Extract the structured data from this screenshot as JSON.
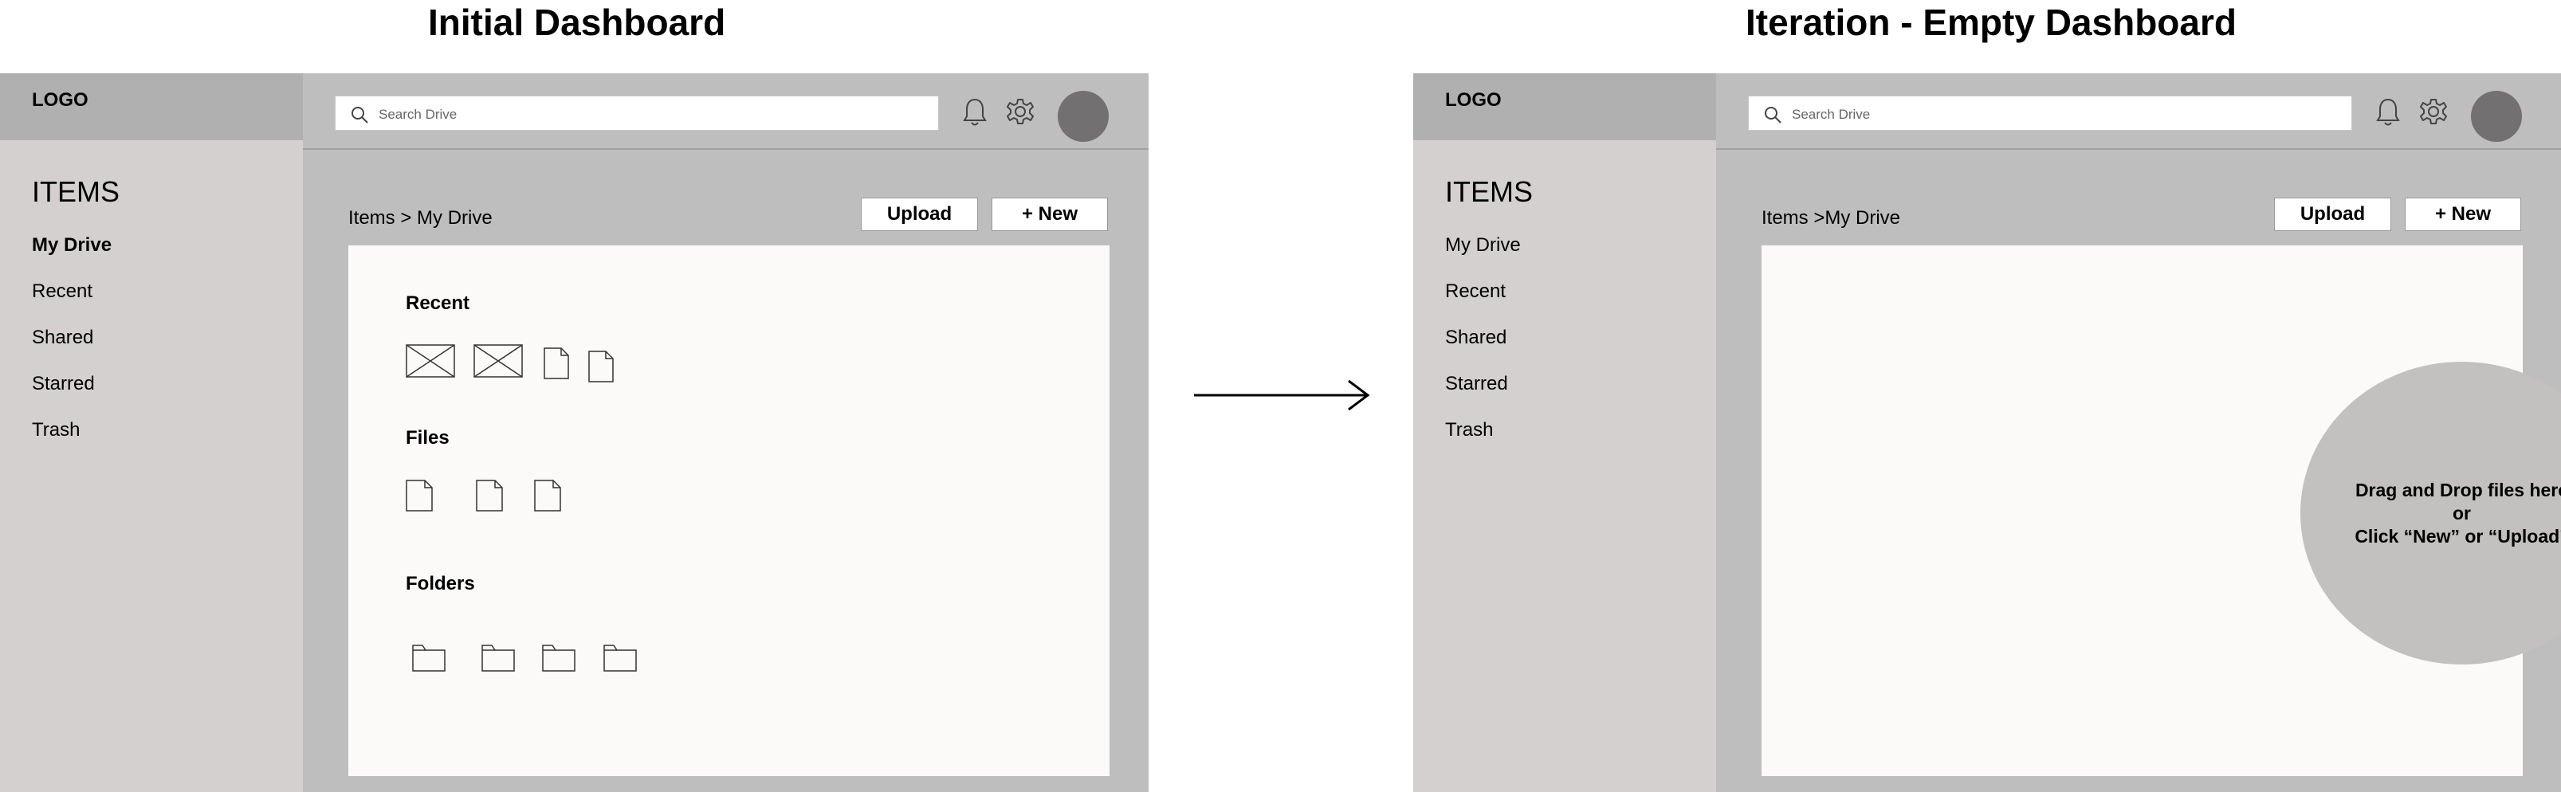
{
  "titles": {
    "initial": "Initial Dashboard",
    "iteration": "Iteration - Empty Dashboard"
  },
  "initial": {
    "logo": "LOGO",
    "items_heading": "ITEMS",
    "nav": [
      "My Drive",
      "Recent",
      "Shared",
      "Starred",
      "Trash"
    ],
    "active_nav": "My Drive",
    "search_placeholder": "Search Drive",
    "breadcrumb": "Items > My Drive",
    "upload_label": "Upload",
    "new_label": "+ New",
    "sections": {
      "recent": "Recent",
      "files": "Files",
      "folders": "Folders"
    },
    "icons": {
      "recent": [
        "image-placeholder-icon",
        "image-placeholder-icon",
        "file-icon",
        "file-icon"
      ],
      "files": [
        "file-icon",
        "file-icon",
        "file-icon"
      ],
      "folders": [
        "folder-icon",
        "folder-icon",
        "folder-icon",
        "folder-icon"
      ]
    }
  },
  "iteration": {
    "logo": "LOGO",
    "items_heading": "ITEMS",
    "nav": [
      "My Drive",
      "Recent",
      "Shared",
      "Starred",
      "Trash"
    ],
    "search_placeholder": "Search Drive",
    "breadcrumb": "Items >My Drive",
    "upload_label": "Upload",
    "new_label": "+ New",
    "dropzone": {
      "line1": "Drag and Drop files here",
      "line2": "or",
      "line3": "Click “New” or “Upload”"
    }
  },
  "colors": {
    "frame_bg": "#bfbebe",
    "sidebar_bg": "#d3d0cf",
    "logo_bar_bg": "#b1b0b0",
    "content_bg": "#fcfaf9",
    "avatar": "#727070",
    "dropzone": "#c2c1c0"
  }
}
